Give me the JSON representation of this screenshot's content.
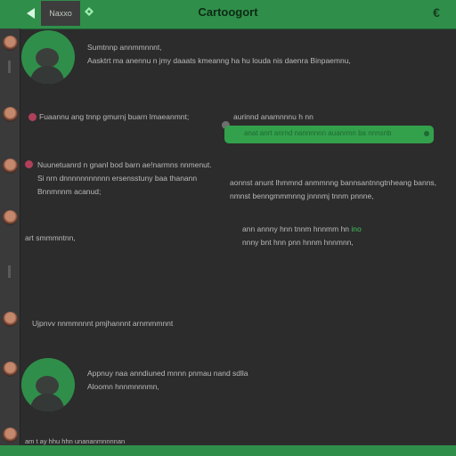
{
  "header": {
    "title": "Cartoogort",
    "tab_label": "Naxxo",
    "accent": "#2f8f4a",
    "icons": [
      "back-arrow-icon",
      "diamond-icon",
      "currency-icon"
    ],
    "right_icon_glyph": "€"
  },
  "left_messages": [
    {
      "lines": [
        "Sumtnnp annmmnnnt,",
        "Aasktrt ma anennu n jmy daaats kmeanng ha hu louda nis daenra Binpaemnu,"
      ]
    },
    {
      "lines": [
        "Fuaannu ang tnnp gmurnj buarn lmaeanmnt;"
      ]
    },
    {
      "lines": [
        "Nuunetuanrd n gnanl bod barn ae!narmns nnmenut.",
        "Si nrn dnnnnnnnnnnn ersensstuny baa thanann",
        "Bnnmnnm acanud;"
      ]
    },
    {
      "lines": [
        "art smmmntnn,"
      ]
    },
    {
      "lines": [
        "Ujpnvv nnmmnnnt pmjhannnt arnmmmnnt"
      ]
    },
    {
      "lines": [
        "Appnuy naa anndiuned mnnn pnmau nand sdlla",
        "Aloomn hnnmnnnmn,"
      ]
    }
  ],
  "right_messages": [
    {
      "lines": [
        "aurinnd anamnnnu h nn"
      ]
    },
    {
      "lines": [
        "anat anrt anrnd nannnnnn auanrmn ba nnnsnb"
      ]
    },
    {
      "lines": [
        "aonnst anunt lhmmnd anmmnng bannsantnngtnheang banns,",
        "nmnst benngmmmnng jnnnmj tnnm pnnne,"
      ]
    },
    {
      "lines": [
        "ann annny hnn tnnm hnnmm hn ",
        "nnny bnt hnn pnn hnnm hnnmnn,"
      ],
      "green_word": "ino"
    }
  ],
  "footer_message": "am t ay hhu hhn unananmnnnnan"
}
